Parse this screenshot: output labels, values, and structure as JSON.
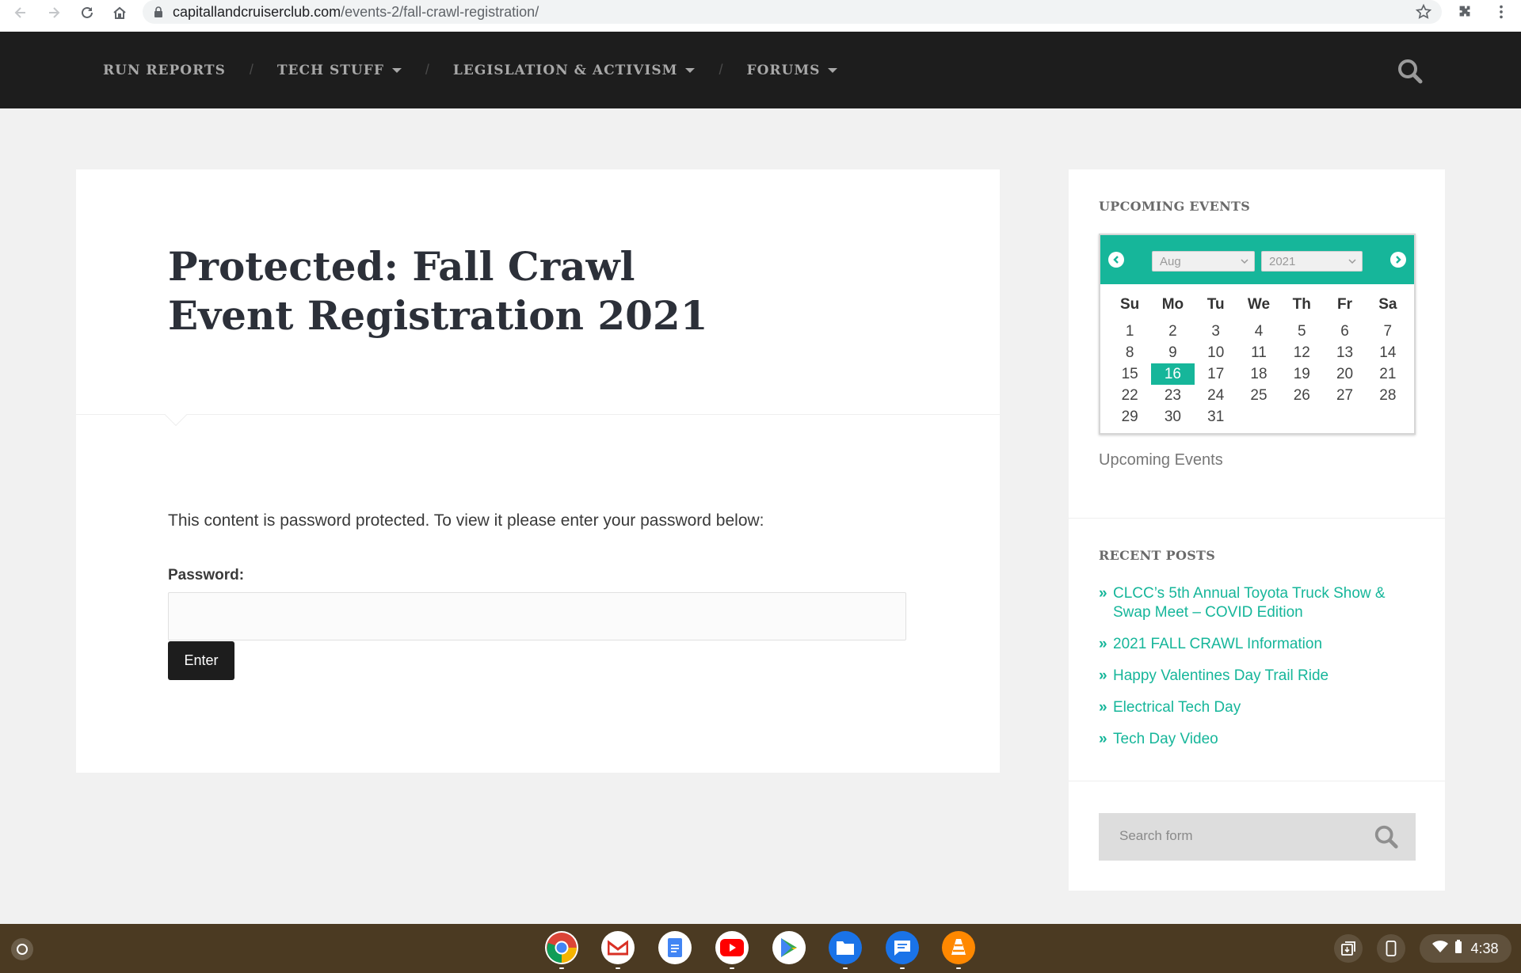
{
  "browser": {
    "url_domain": "capitallandcruiserclub.com",
    "url_path": "/events-2/fall-crawl-registration/"
  },
  "nav": {
    "items": [
      {
        "label": "RUN REPORTS",
        "has_dropdown": false
      },
      {
        "label": "TECH STUFF",
        "has_dropdown": true
      },
      {
        "label": "LEGISLATION & ACTIVISM",
        "has_dropdown": true
      },
      {
        "label": "FORUMS",
        "has_dropdown": true
      }
    ],
    "separator": "/"
  },
  "article": {
    "title": "Protected: Fall Crawl Event Registration 2021",
    "protected_text": "This content is password protected. To view it please enter your password below:",
    "password_label": "Password:",
    "password_value": "",
    "enter_label": "Enter"
  },
  "sidebar": {
    "events_title": "UPCOMING EVENTS",
    "calendar": {
      "month": "Aug",
      "year": "2021",
      "weekdays": [
        "Su",
        "Mo",
        "Tu",
        "We",
        "Th",
        "Fr",
        "Sa"
      ],
      "weeks": [
        [
          "1",
          "2",
          "3",
          "4",
          "5",
          "6",
          "7"
        ],
        [
          "8",
          "9",
          "10",
          "11",
          "12",
          "13",
          "14"
        ],
        [
          "15",
          "16",
          "17",
          "18",
          "19",
          "20",
          "21"
        ],
        [
          "22",
          "23",
          "24",
          "25",
          "26",
          "27",
          "28"
        ],
        [
          "29",
          "30",
          "31",
          "",
          "",
          "",
          ""
        ]
      ],
      "today": "16",
      "caption": "Upcoming Events"
    },
    "recent_title": "RECENT POSTS",
    "recent_posts": [
      "CLCC’s 5th Annual Toyota Truck Show & Swap Meet – COVID Edition",
      "2021 FALL CRAWL Information",
      "Happy Valentines Day Trail Ride",
      "Electrical Tech Day",
      "Tech Day Video"
    ],
    "search_placeholder": "Search form"
  },
  "shelf": {
    "apps": [
      "chrome-icon",
      "gmail-icon",
      "docs-icon",
      "youtube-icon",
      "play-store-icon",
      "files-icon",
      "messages-icon",
      "vlc-icon"
    ],
    "time": "4:38"
  },
  "colors": {
    "accent": "#16b69a",
    "header_bg": "#1d1d1d",
    "page_bg": "#f1f1f1",
    "shelf_bg": "#4b3a22"
  }
}
